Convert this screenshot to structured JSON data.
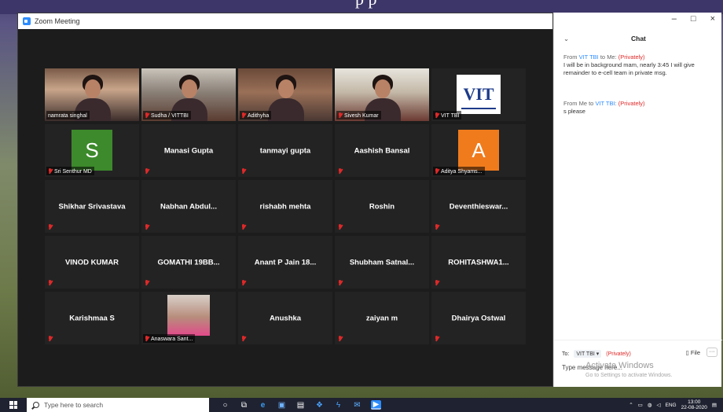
{
  "window": {
    "title": "Zoom Meeting"
  },
  "participants": [
    {
      "name": "namrata singhal",
      "video": true,
      "feed": "feed-1"
    },
    {
      "name": "Sudha / VITTBI",
      "video": true,
      "feed": "feed-2"
    },
    {
      "name": "Adithyha",
      "video": true,
      "feed": "feed-3",
      "active": true
    },
    {
      "name": "Sivesh Kumar",
      "video": true,
      "feed": "feed-4"
    },
    {
      "name": "VIT TBI",
      "video": true,
      "logo": "VIT"
    },
    {
      "name": "Sri Senthur MD",
      "avatar": "S",
      "avatar_color": "#3d8a2c"
    },
    {
      "name": "Manasi Gupta"
    },
    {
      "name": "tanmayi gupta"
    },
    {
      "name": "Aashish Bansal"
    },
    {
      "name": "Aditya Shyams...",
      "avatar": "A",
      "avatar_color": "#f07b1d"
    },
    {
      "name": "Shikhar Srivastava"
    },
    {
      "name": "Nabhan Abdul..."
    },
    {
      "name": "rishabh mehta"
    },
    {
      "name": "Roshin"
    },
    {
      "name": "Deventhieswar..."
    },
    {
      "name": "VINOD KUMAR"
    },
    {
      "name": "GOMATHI 19BB..."
    },
    {
      "name": "Anant P Jain 18..."
    },
    {
      "name": "Shubham Satnal..."
    },
    {
      "name": "ROHITASHWA1..."
    },
    {
      "name": "Karishmaa S"
    },
    {
      "name": "Anaswara Sant...",
      "photo": true
    },
    {
      "name": "Anushka"
    },
    {
      "name": "zaiyan m"
    },
    {
      "name": "Dhairya Ostwal"
    }
  ],
  "chat": {
    "title": "Chat",
    "collapse_icon": "chevron-down-icon",
    "controls": [
      "–",
      "□",
      "×"
    ],
    "messages": [
      {
        "from": "VIT TBI",
        "to": "Me",
        "privately": "(Privately)",
        "text": "I will be in background mam, nearly 3:45 I will give remainder to e-cell team in private msg."
      },
      {
        "from": "Me",
        "to": "VIT TBI",
        "privately": "(Privately)",
        "text": "s please"
      }
    ],
    "footer": {
      "to_label": "To:",
      "to_value": "VIT TBI",
      "privately": "(Privately)",
      "file_label": "File",
      "more_label": "···",
      "input_placeholder": "Type message here...",
      "watermark_title": "Activate Windows",
      "watermark_sub": "Go to Settings to activate Windows."
    }
  },
  "taskbar": {
    "search_placeholder": "Type here to search",
    "tray": {
      "lang": "ENG",
      "time": "13:00",
      "date": "22-08-2020"
    }
  },
  "desktop": {
    "banner_text": "p   p"
  }
}
